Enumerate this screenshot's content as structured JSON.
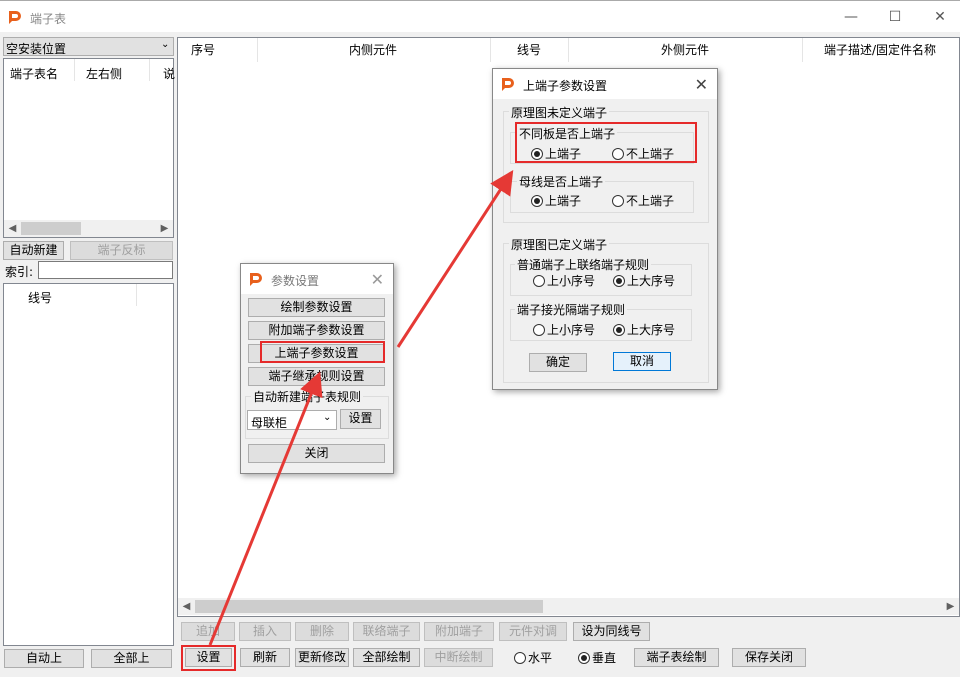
{
  "window": {
    "title": "端子表",
    "minimize_icon": "minimize-icon",
    "maximize_icon": "maximize-icon",
    "close_icon": "close-icon"
  },
  "left": {
    "location_select": "空安装位置",
    "list_headers": [
      "端子表名",
      "左右侧",
      "说"
    ],
    "auto_new": "自动新建",
    "terminal_reverse": "端子反标",
    "index_label": "索引:",
    "index_value": "",
    "line_header": "线号",
    "auto_up": "自动上",
    "all_up": "全部上"
  },
  "table": {
    "headers": [
      "序号",
      "内侧元件",
      "线号",
      "外侧元件",
      "端子描述/固定件名称"
    ]
  },
  "toolbar1": [
    "追加",
    "插入",
    "删除",
    "联络端子",
    "附加端子",
    "元件对调",
    "设为同线号"
  ],
  "toolbar2": {
    "settings": "设置",
    "refresh": "刷新",
    "update": "更新修改",
    "draw_all": "全部绘制",
    "interrupt_draw": "中断绘制",
    "horizontal": "水平",
    "vertical": "垂直",
    "table_draw": "端子表绘制",
    "save_close": "保存关闭",
    "orientation_selected": "垂直"
  },
  "param_dialog": {
    "title": "参数设置",
    "buttons": [
      "绘制参数设置",
      "附加端子参数设置",
      "上端子参数设置",
      "端子继承规则设置"
    ],
    "rule_group": "自动新建端子表规则",
    "rule_select": "母联柜",
    "rule_set": "设置",
    "close": "关闭"
  },
  "terminal_dialog": {
    "title": "上端子参数设置",
    "group1": "原理图未定义端子",
    "sub1": "不同板是否上端子",
    "sub1_opts": [
      "上端子",
      "不上端子"
    ],
    "sub2": "母线是否上端子",
    "sub2_opts": [
      "上端子",
      "不上端子"
    ],
    "group2": "原理图已定义端子",
    "sub3": "普通端子上联络端子规则",
    "sub3_opts": [
      "上小序号",
      "上大序号"
    ],
    "sub4": "端子接光隔端子规则",
    "sub4_opts": [
      "上小序号",
      "上大序号"
    ],
    "ok": "确定",
    "cancel": "取消"
  },
  "colors": {
    "highlight": "#e52a2a",
    "arrow": "#e53935",
    "brand": "#e8601c"
  }
}
